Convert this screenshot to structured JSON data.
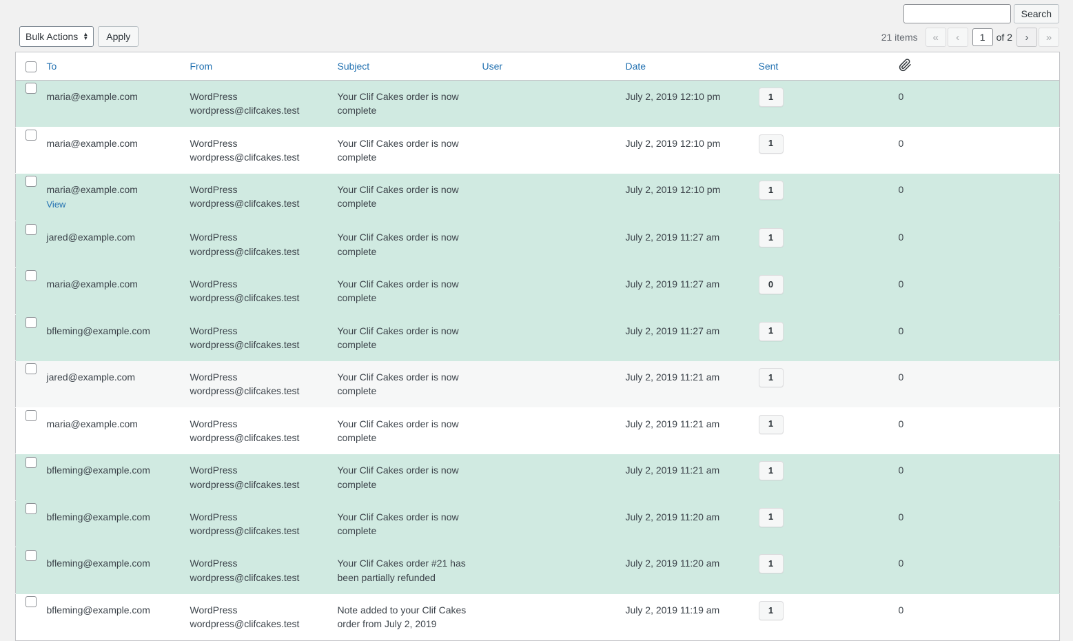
{
  "toolbar": {
    "bulk_actions_label": "Bulk Actions",
    "apply_label": "Apply"
  },
  "search": {
    "value": "",
    "placeholder": "",
    "button_label": "Search"
  },
  "pagination": {
    "items_label": "21 items",
    "first_label": "«",
    "prev_label": "‹",
    "current_page": "1",
    "of_label": "of 2",
    "next_label": "›",
    "last_label": "»"
  },
  "table": {
    "columns": [
      {
        "key": "cb",
        "label": "",
        "icon": "checkbox-icon"
      },
      {
        "key": "to",
        "label": "To"
      },
      {
        "key": "from",
        "label": "From"
      },
      {
        "key": "subject",
        "label": "Subject"
      },
      {
        "key": "user",
        "label": "User"
      },
      {
        "key": "date",
        "label": "Date"
      },
      {
        "key": "sent",
        "label": "Sent"
      },
      {
        "key": "attach",
        "label": "",
        "icon": "paperclip-icon"
      }
    ],
    "row_action_label": "View",
    "rows": [
      {
        "to": "maria@example.com",
        "from_name": "WordPress",
        "from_email": "wordpress@clifcakes.test",
        "subject": "Your Clif Cakes order is now complete",
        "user": "",
        "date": "July 2, 2019 12:10 pm",
        "sent": "1",
        "attachments": "0",
        "highlight": "green",
        "show_actions": false
      },
      {
        "to": "maria@example.com",
        "from_name": "WordPress",
        "from_email": "wordpress@clifcakes.test",
        "subject": "Your Clif Cakes order is now complete",
        "user": "",
        "date": "July 2, 2019 12:10 pm",
        "sent": "1",
        "attachments": "0",
        "highlight": "white",
        "show_actions": false
      },
      {
        "to": "maria@example.com",
        "from_name": "WordPress",
        "from_email": "wordpress@clifcakes.test",
        "subject": "Your Clif Cakes order is now complete",
        "user": "",
        "date": "July 2, 2019 12:10 pm",
        "sent": "1",
        "attachments": "0",
        "highlight": "green",
        "show_actions": true
      },
      {
        "to": "jared@example.com",
        "from_name": "WordPress",
        "from_email": "wordpress@clifcakes.test",
        "subject": "Your Clif Cakes order is now complete",
        "user": "",
        "date": "July 2, 2019 11:27 am",
        "sent": "1",
        "attachments": "0",
        "highlight": "green",
        "show_actions": false
      },
      {
        "to": "maria@example.com",
        "from_name": "WordPress",
        "from_email": "wordpress@clifcakes.test",
        "subject": "Your Clif Cakes order is now complete",
        "user": "",
        "date": "July 2, 2019 11:27 am",
        "sent": "0",
        "attachments": "0",
        "highlight": "green",
        "show_actions": false
      },
      {
        "to": "bfleming@example.com",
        "from_name": "WordPress",
        "from_email": "wordpress@clifcakes.test",
        "subject": "Your Clif Cakes order is now complete",
        "user": "",
        "date": "July 2, 2019 11:27 am",
        "sent": "1",
        "attachments": "0",
        "highlight": "green",
        "show_actions": false
      },
      {
        "to": "jared@example.com",
        "from_name": "WordPress",
        "from_email": "wordpress@clifcakes.test",
        "subject": "Your Clif Cakes order is now complete",
        "user": "",
        "date": "July 2, 2019 11:21 am",
        "sent": "1",
        "attachments": "0",
        "highlight": "gray",
        "show_actions": false
      },
      {
        "to": "maria@example.com",
        "from_name": "WordPress",
        "from_email": "wordpress@clifcakes.test",
        "subject": "Your Clif Cakes order is now complete",
        "user": "",
        "date": "July 2, 2019 11:21 am",
        "sent": "1",
        "attachments": "0",
        "highlight": "white",
        "show_actions": false
      },
      {
        "to": "bfleming@example.com",
        "from_name": "WordPress",
        "from_email": "wordpress@clifcakes.test",
        "subject": "Your Clif Cakes order is now complete",
        "user": "",
        "date": "July 2, 2019 11:21 am",
        "sent": "1",
        "attachments": "0",
        "highlight": "green",
        "show_actions": false
      },
      {
        "to": "bfleming@example.com",
        "from_name": "WordPress",
        "from_email": "wordpress@clifcakes.test",
        "subject": "Your Clif Cakes order is now complete",
        "user": "",
        "date": "July 2, 2019 11:20 am",
        "sent": "1",
        "attachments": "0",
        "highlight": "green",
        "show_actions": false
      },
      {
        "to": "bfleming@example.com",
        "from_name": "WordPress",
        "from_email": "wordpress@clifcakes.test",
        "subject": "Your Clif Cakes order #21 has been partially refunded",
        "user": "",
        "date": "July 2, 2019 11:20 am",
        "sent": "1",
        "attachments": "0",
        "highlight": "green",
        "show_actions": false
      },
      {
        "to": "bfleming@example.com",
        "from_name": "WordPress",
        "from_email": "wordpress@clifcakes.test",
        "subject": "Note added to your Clif Cakes order from July 2, 2019",
        "user": "",
        "date": "July 2, 2019 11:19 am",
        "sent": "1",
        "attachments": "0",
        "highlight": "white",
        "show_actions": false
      }
    ]
  },
  "colors": {
    "link": "#2271b1",
    "row_highlight": "#d0eae1",
    "page_background": "#f1f1f1"
  }
}
